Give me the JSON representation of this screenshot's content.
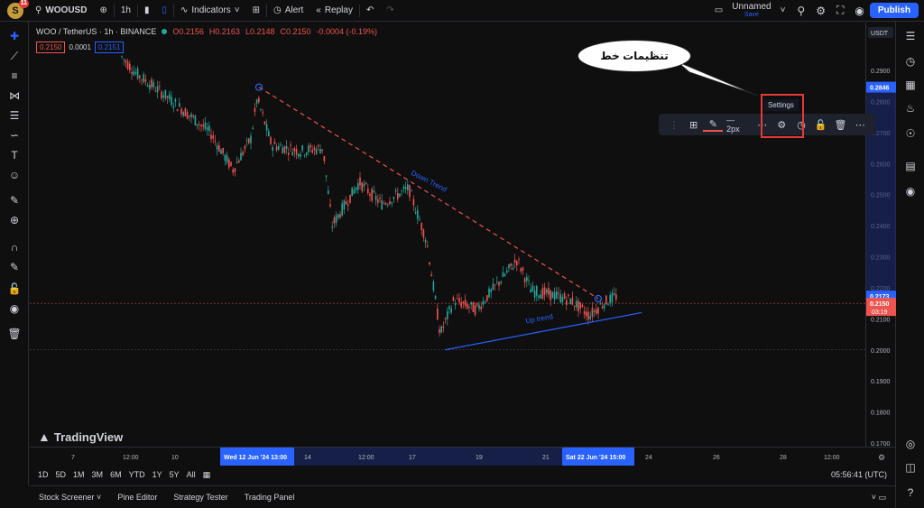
{
  "topbar": {
    "avatar_letter": "S",
    "avatar_badge": "11",
    "symbol": "WOOUSD",
    "interval": "1h",
    "indicators_label": "Indicators",
    "alert_label": "Alert",
    "replay_label": "Replay",
    "layout_name": "Unnamed",
    "layout_save": "Save",
    "publish_label": "Publish"
  },
  "legend": {
    "title": "WOO / TetherUS · 1h · BINANCE",
    "open": "O0.2156",
    "high": "H0.2163",
    "low": "L0.2148",
    "close": "C0.2150",
    "change": "-0.0004 (-0.19%)",
    "sell_price": "0.2150",
    "spread": "0.0001",
    "buy_price": "0.2151"
  },
  "price_axis": {
    "currency": "USDT",
    "ticks": [
      "0.2900",
      "0.2800",
      "0.2700",
      "0.2600",
      "0.2500",
      "0.2400",
      "0.2300",
      "0.2200",
      "0.2100",
      "0.2000",
      "0.1900",
      "0.1800",
      "0.1700"
    ],
    "marker_high": "0.2846",
    "marker_mid": "0.2173",
    "marker_current": "0.2150",
    "marker_countdown": "03:19"
  },
  "time_axis": {
    "ticks": [
      "7",
      "12:00",
      "10",
      "12:00",
      "17",
      "19",
      "21",
      "24",
      "26",
      "28",
      "12:00"
    ],
    "highlight_left": "Wed 12 Jun '24  13:00",
    "highlight_right": "Sat 22 Jun '24  15:00",
    "highlight_mid": "14"
  },
  "drawings": {
    "down_trend_label": "Down Trend",
    "up_trend_label": "Up trend"
  },
  "draw_toolbar": {
    "width_label": "2px",
    "tooltip": "Settings"
  },
  "callout": {
    "text": "تنظیمات خط"
  },
  "ranges": [
    "1D",
    "5D",
    "1M",
    "3M",
    "6M",
    "YTD",
    "1Y",
    "5Y",
    "All"
  ],
  "clock": "05:56:41 (UTC)",
  "bottom_tabs": [
    "Stock Screener",
    "Pine Editor",
    "Strategy Tester",
    "Trading Panel"
  ],
  "watermark": "TradingView",
  "colors": {
    "up": "#26a69a",
    "down": "#ef5350",
    "accent": "#2962ff",
    "highlight": "#e53935"
  }
}
